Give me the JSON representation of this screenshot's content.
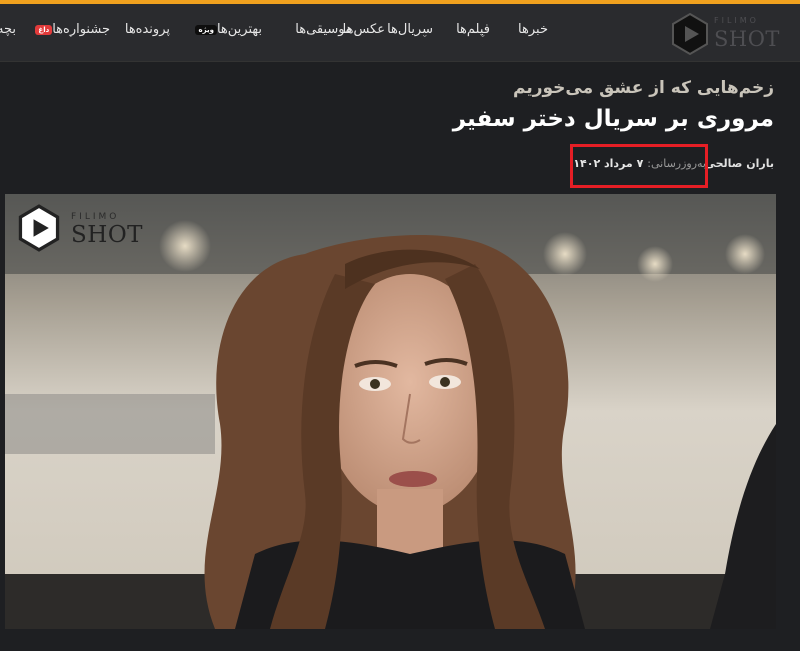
{
  "brand": {
    "filimo": "FILIMO",
    "shot": "SHOT"
  },
  "nav": {
    "items": [
      {
        "label": "خبرها"
      },
      {
        "label": "فیلم‌ها"
      },
      {
        "label": "سریال‌ها"
      },
      {
        "label": "عکس‌ها"
      },
      {
        "label": "موسیقی‌ها"
      },
      {
        "label": "بهترین‌ها"
      },
      {
        "label": "پرونده‌ها"
      },
      {
        "label": "جشنواره‌ها"
      },
      {
        "label": "بچه"
      }
    ],
    "badge_live": "داغ",
    "badge_special": "ویژه"
  },
  "article": {
    "subtitle": "زخم‌هایی که از عشق می‌خوریم",
    "title": "مروری بر سریال دختر سفیر",
    "author": "باران صالحی",
    "update_label": "به‌روزرسانی:",
    "update_date": "۷ مرداد ۱۴۰۲"
  },
  "colors": {
    "accent": "#f0a11e",
    "highlight_box": "#e51e25",
    "nav_bg": "#2a2b2e",
    "page_bg": "#1e1f22"
  }
}
